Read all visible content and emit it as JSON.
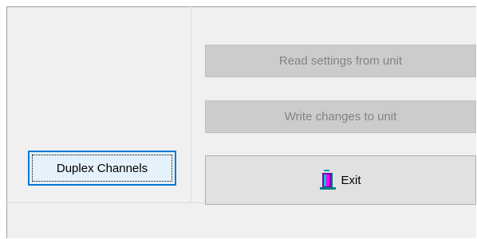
{
  "buttons": {
    "read_settings": "Read settings from unit",
    "write_changes": "Write changes to unit",
    "exit": "Exit",
    "duplex_channels": "Duplex Channels"
  },
  "icons": {
    "exit": "exit-door-icon"
  },
  "colors": {
    "focus_border": "#0078d7",
    "disabled_text": "#838383",
    "window_bg": "#f0f0f0"
  }
}
